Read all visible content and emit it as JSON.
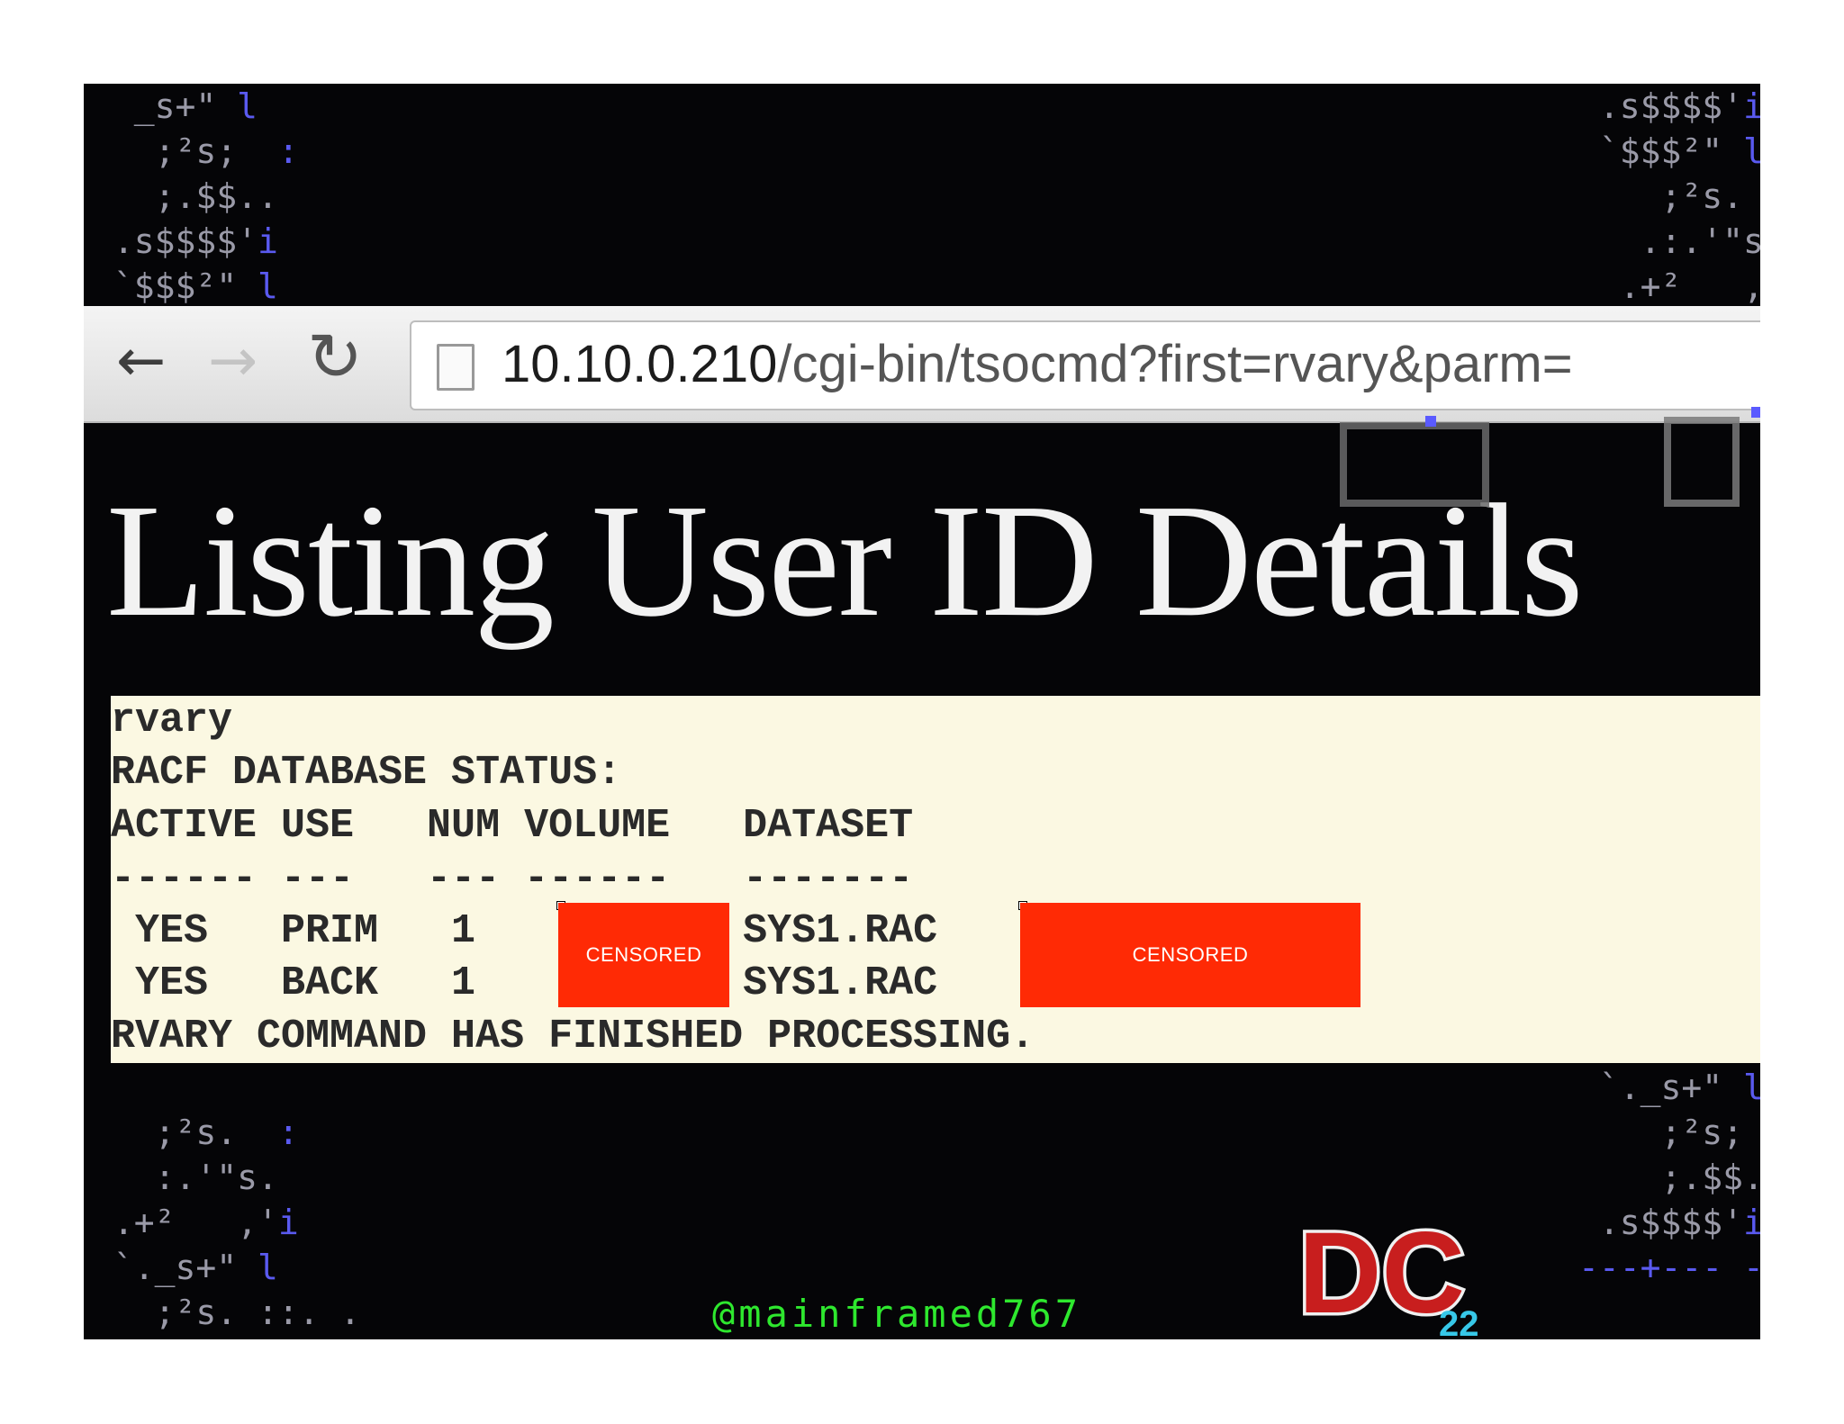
{
  "browser": {
    "url_host": "10.10.0.210",
    "url_path": "/cgi-bin/tsocmd?first=rvary&parm=",
    "icons": [
      "back-arrow-icon",
      "forward-arrow-icon",
      "reload-icon",
      "page-icon"
    ]
  },
  "page": {
    "title": "Listing User ID Details"
  },
  "terminal": {
    "lines": [
      "rvary",
      "RACF DATABASE STATUS:",
      "ACTIVE USE   NUM VOLUME   DATASET",
      "------ ---   --- ------   -------",
      " YES   PRIM   1           SYS1.RAC",
      " YES   BACK   1           SYS1.RAC",
      "RVARY COMMAND HAS FINISHED PROCESSING."
    ],
    "censor_label_1": "CENSORED",
    "censor_label_2": "CENSORED"
  },
  "footer": {
    "credit": "@mainframed767",
    "logo_text": "DC",
    "logo_sub": "22"
  },
  "colors": {
    "slide_bg": "#050507",
    "terminal_bg": "#fbf8e2",
    "censor": "#ff2a05",
    "credit": "#2ee82e"
  }
}
